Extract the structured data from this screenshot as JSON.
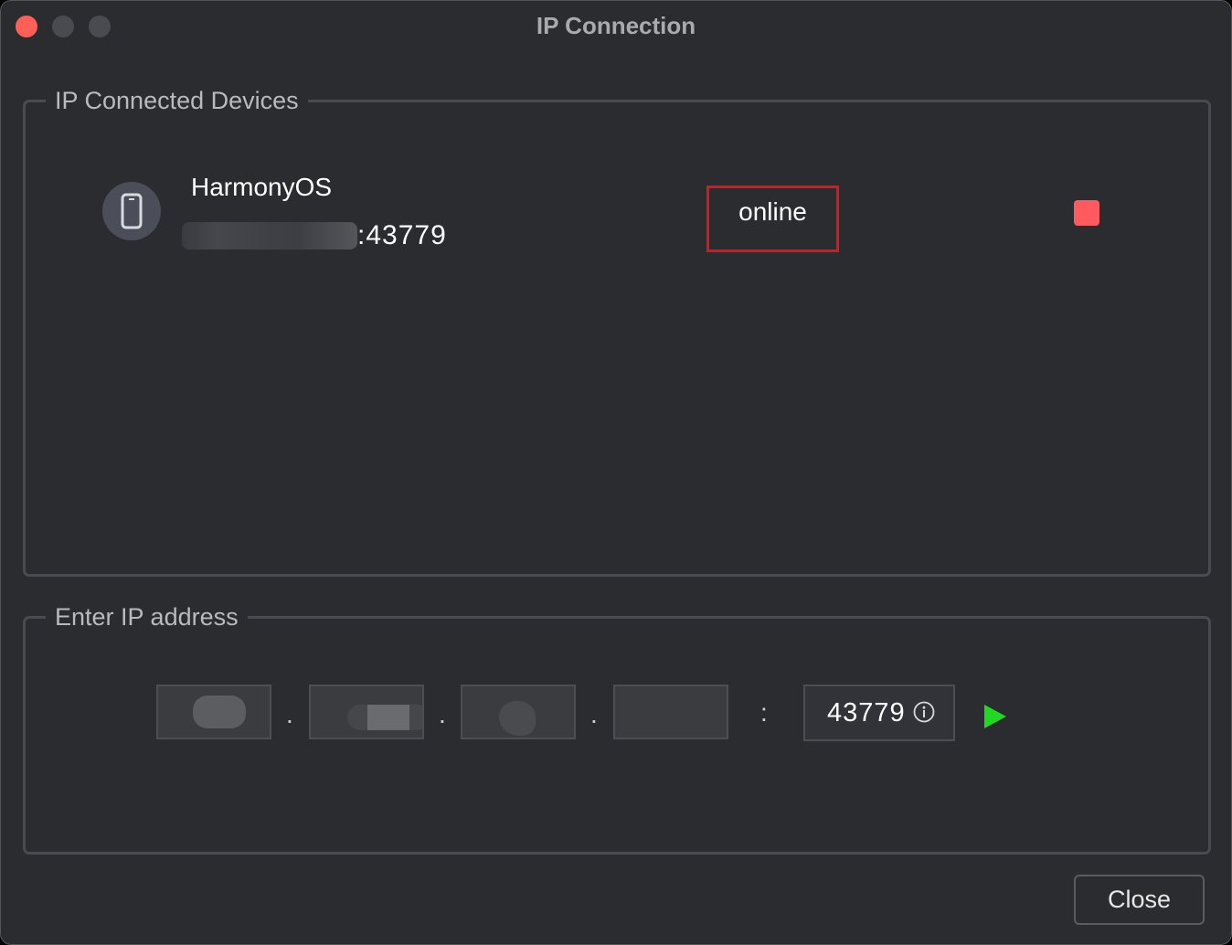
{
  "window": {
    "title": "IP Connection"
  },
  "devices_group": {
    "legend": "IP Connected Devices",
    "devices": [
      {
        "name": "HarmonyOS",
        "address_suffix": ":43779",
        "status": "online",
        "icon": "phone-icon",
        "stop_icon": "stop-icon"
      }
    ]
  },
  "ip_group": {
    "legend": "Enter IP address",
    "octets": [
      "",
      "",
      "",
      ""
    ],
    "separator": ".",
    "port_separator": ":",
    "port": "43779",
    "info_icon": "info-icon",
    "connect_icon": "play-icon"
  },
  "footer": {
    "close_label": "Close"
  },
  "colors": {
    "window_bg": "#2b2c30",
    "status_highlight": "#e0141c",
    "stop_button": "#ff5a5d",
    "connect_button": "#22d922",
    "close_traffic_light": "#fe5f57"
  }
}
